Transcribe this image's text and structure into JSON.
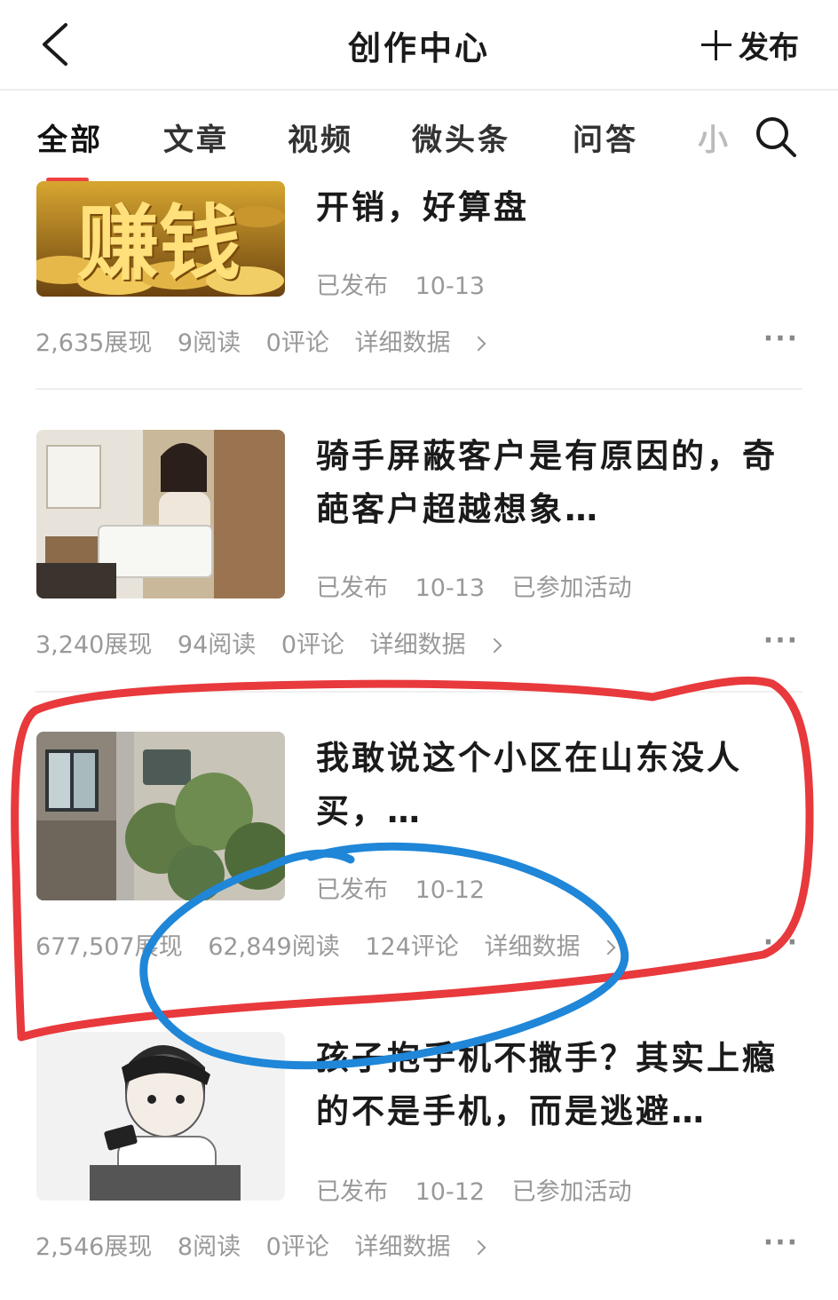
{
  "header": {
    "title": "创作中心",
    "publish_label": "发布"
  },
  "tabs": [
    {
      "label": "全部"
    },
    {
      "label": "文章"
    },
    {
      "label": "视频"
    },
    {
      "label": "微头条"
    },
    {
      "label": "问答"
    },
    {
      "label": "小"
    }
  ],
  "items": [
    {
      "thumb_text": "赚钱",
      "title": "开销，好算盘",
      "status": "已发布",
      "date": "10-13",
      "activity": "",
      "views": "2,635展现",
      "reads": "9阅读",
      "comments": "0评论",
      "detail": "详细数据"
    },
    {
      "title": "骑手屏蔽客户是有原因的，奇葩客户超越想象…",
      "status": "已发布",
      "date": "10-13",
      "activity": "已参加活动",
      "views": "3,240展现",
      "reads": "94阅读",
      "comments": "0评论",
      "detail": "详细数据"
    },
    {
      "title": "我敢说这个小区在山东没人买，…",
      "status": "已发布",
      "date": "10-12",
      "activity": "",
      "views": "677,507展现",
      "reads": "62,849阅读",
      "comments": "124评论",
      "detail": "详细数据"
    },
    {
      "title": "孩子抱手机不撒手？其实上瘾的不是手机，而是逃避…",
      "status": "已发布",
      "date": "10-12",
      "activity": "已参加活动",
      "views": "2,546展现",
      "reads": "8阅读",
      "comments": "0评论",
      "detail": "详细数据"
    }
  ],
  "colors": {
    "accent": "#f04142",
    "annotation_red": "#e8393c",
    "annotation_blue": "#1f86d8"
  },
  "icons": {
    "back": "chevron-left-icon",
    "search": "search-icon",
    "more": "more-dots-icon",
    "plus": "plus-icon"
  }
}
